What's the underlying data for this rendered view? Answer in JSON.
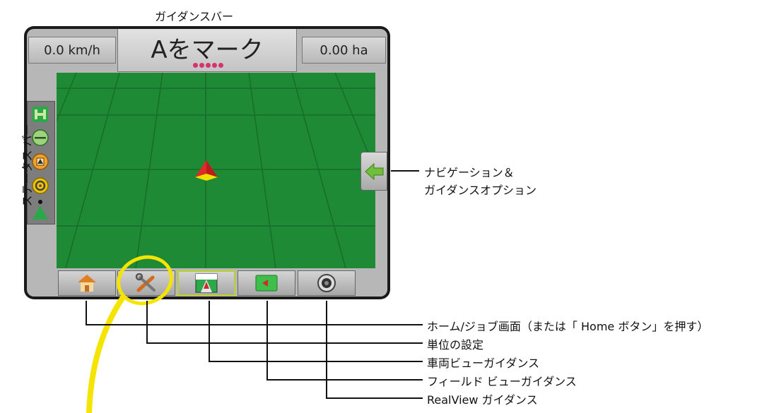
{
  "labels": {
    "guidance_bar": "ガイダンスバー",
    "status_bar": "ステータス バー",
    "nav_line1": "ナビゲーション＆",
    "nav_line2": "ガイダンスオプション",
    "home": "ホーム/ジョブ画面（または「 Home ボタン」を押す）",
    "units": "単位の設定",
    "vehicle_view": "車両ビューガイダンス",
    "field_view": "フィールド ビューガイダンス",
    "realview": "RealView ガイダンス"
  },
  "screen": {
    "speed": "0.0 km/h",
    "area": "0.00 ha",
    "guidance_message": "Aをマーク",
    "lightbar_dots": 5
  },
  "colors": {
    "field": "#1e8a35",
    "highlight": "#f5e400",
    "lightbar": "#d6336c"
  },
  "icons": {
    "status": [
      "gnss-status-icon",
      "boom-section-icon",
      "tilt-icon",
      "steering-icon",
      "vehicle-icon"
    ],
    "bottom": [
      "home-icon",
      "tools-icon",
      "vehicle-view-icon",
      "field-view-icon",
      "realview-camera-icon"
    ],
    "nav": "arrow-left-icon"
  }
}
